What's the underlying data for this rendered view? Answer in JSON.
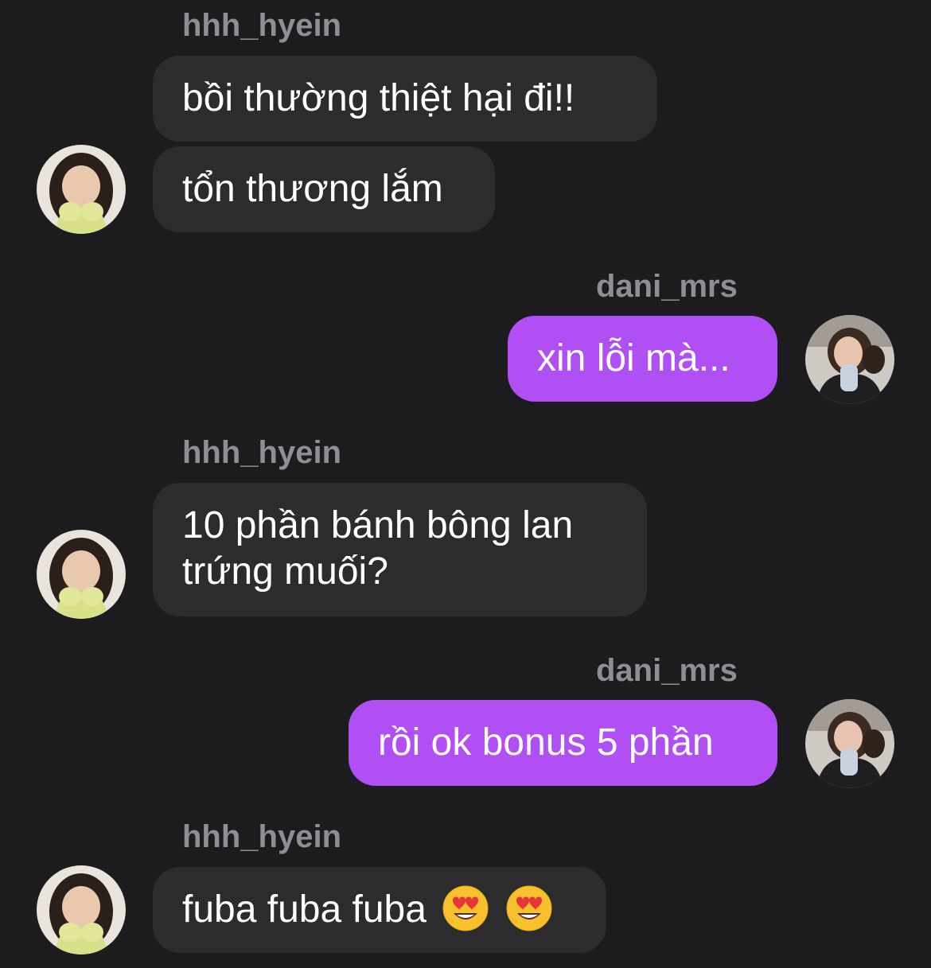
{
  "messages": [
    {
      "sender": "hhh_hyein",
      "text": "bồi thường thiệt hại đi!!"
    },
    {
      "sender": "hhh_hyein",
      "text": "tổn thương lắm"
    },
    {
      "sender": "dani_mrs",
      "text": "xin lỗi mà..."
    },
    {
      "sender": "hhh_hyein",
      "line1": "10 phần bánh bông lan",
      "line2": "trứng muối?"
    },
    {
      "sender": "dani_mrs",
      "text": "rồi ok bonus 5 phần"
    },
    {
      "sender": "hhh_hyein",
      "text": "fuba fuba fuba",
      "emojis": [
        "heart-eyes-emoji",
        "heart-eyes-emoji"
      ]
    }
  ],
  "colors": {
    "background": "#1c1c1e",
    "incoming_bubble": "#2c2c2e",
    "outgoing_bubble": "#b04ff4",
    "username": "#8e8e93"
  }
}
